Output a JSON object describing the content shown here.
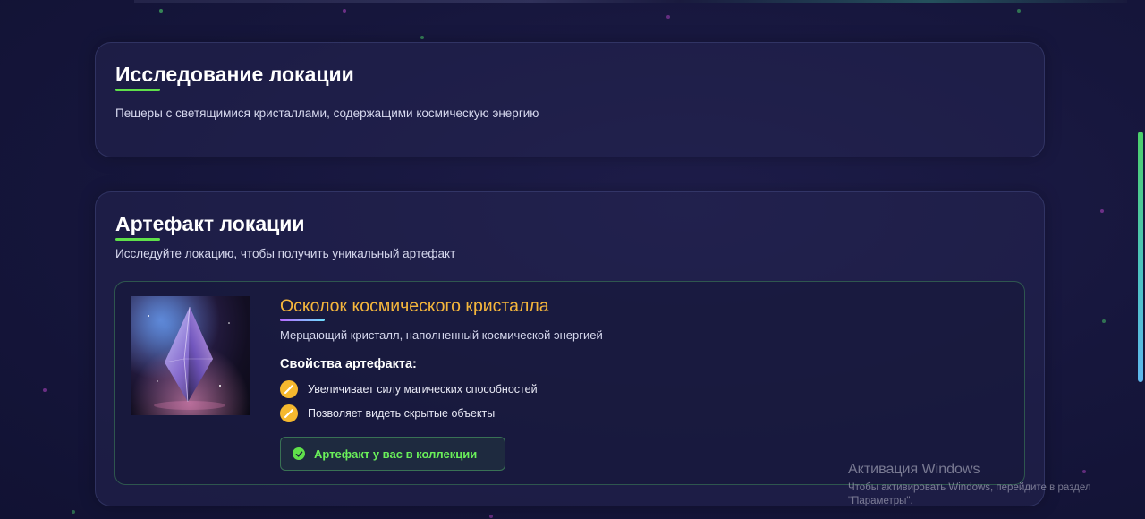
{
  "location": {
    "title": "Исследование локации",
    "description": "Пещеры с светящимися кристаллами, содержащими космическую энергию"
  },
  "artifact_section": {
    "title": "Артефакт локации",
    "description": "Исследуйте локацию, чтобы получить уникальный артефакт",
    "artifact": {
      "name": "Осколок космического кристалла",
      "description": "Мерцающий кристалл, наполненный космической энергией",
      "properties_title": "Свойства артефакта:",
      "properties": [
        "Увеличивает силу магических способностей",
        "Позволяет видеть скрытые объекты"
      ],
      "property_icon": "wand-icon",
      "status": "Артефакт у вас в коллекции",
      "status_icon": "check-circle-icon"
    }
  },
  "windows_watermark": {
    "title": "Активация Windows",
    "subtitle": "Чтобы активировать Windows, перейдите в раздел \"Параметры\"."
  },
  "colors": {
    "accent_green": "#5fe04a",
    "artifact_name": "#f6b73c",
    "property_icon": "#f5b82e",
    "background": "#15163a"
  }
}
